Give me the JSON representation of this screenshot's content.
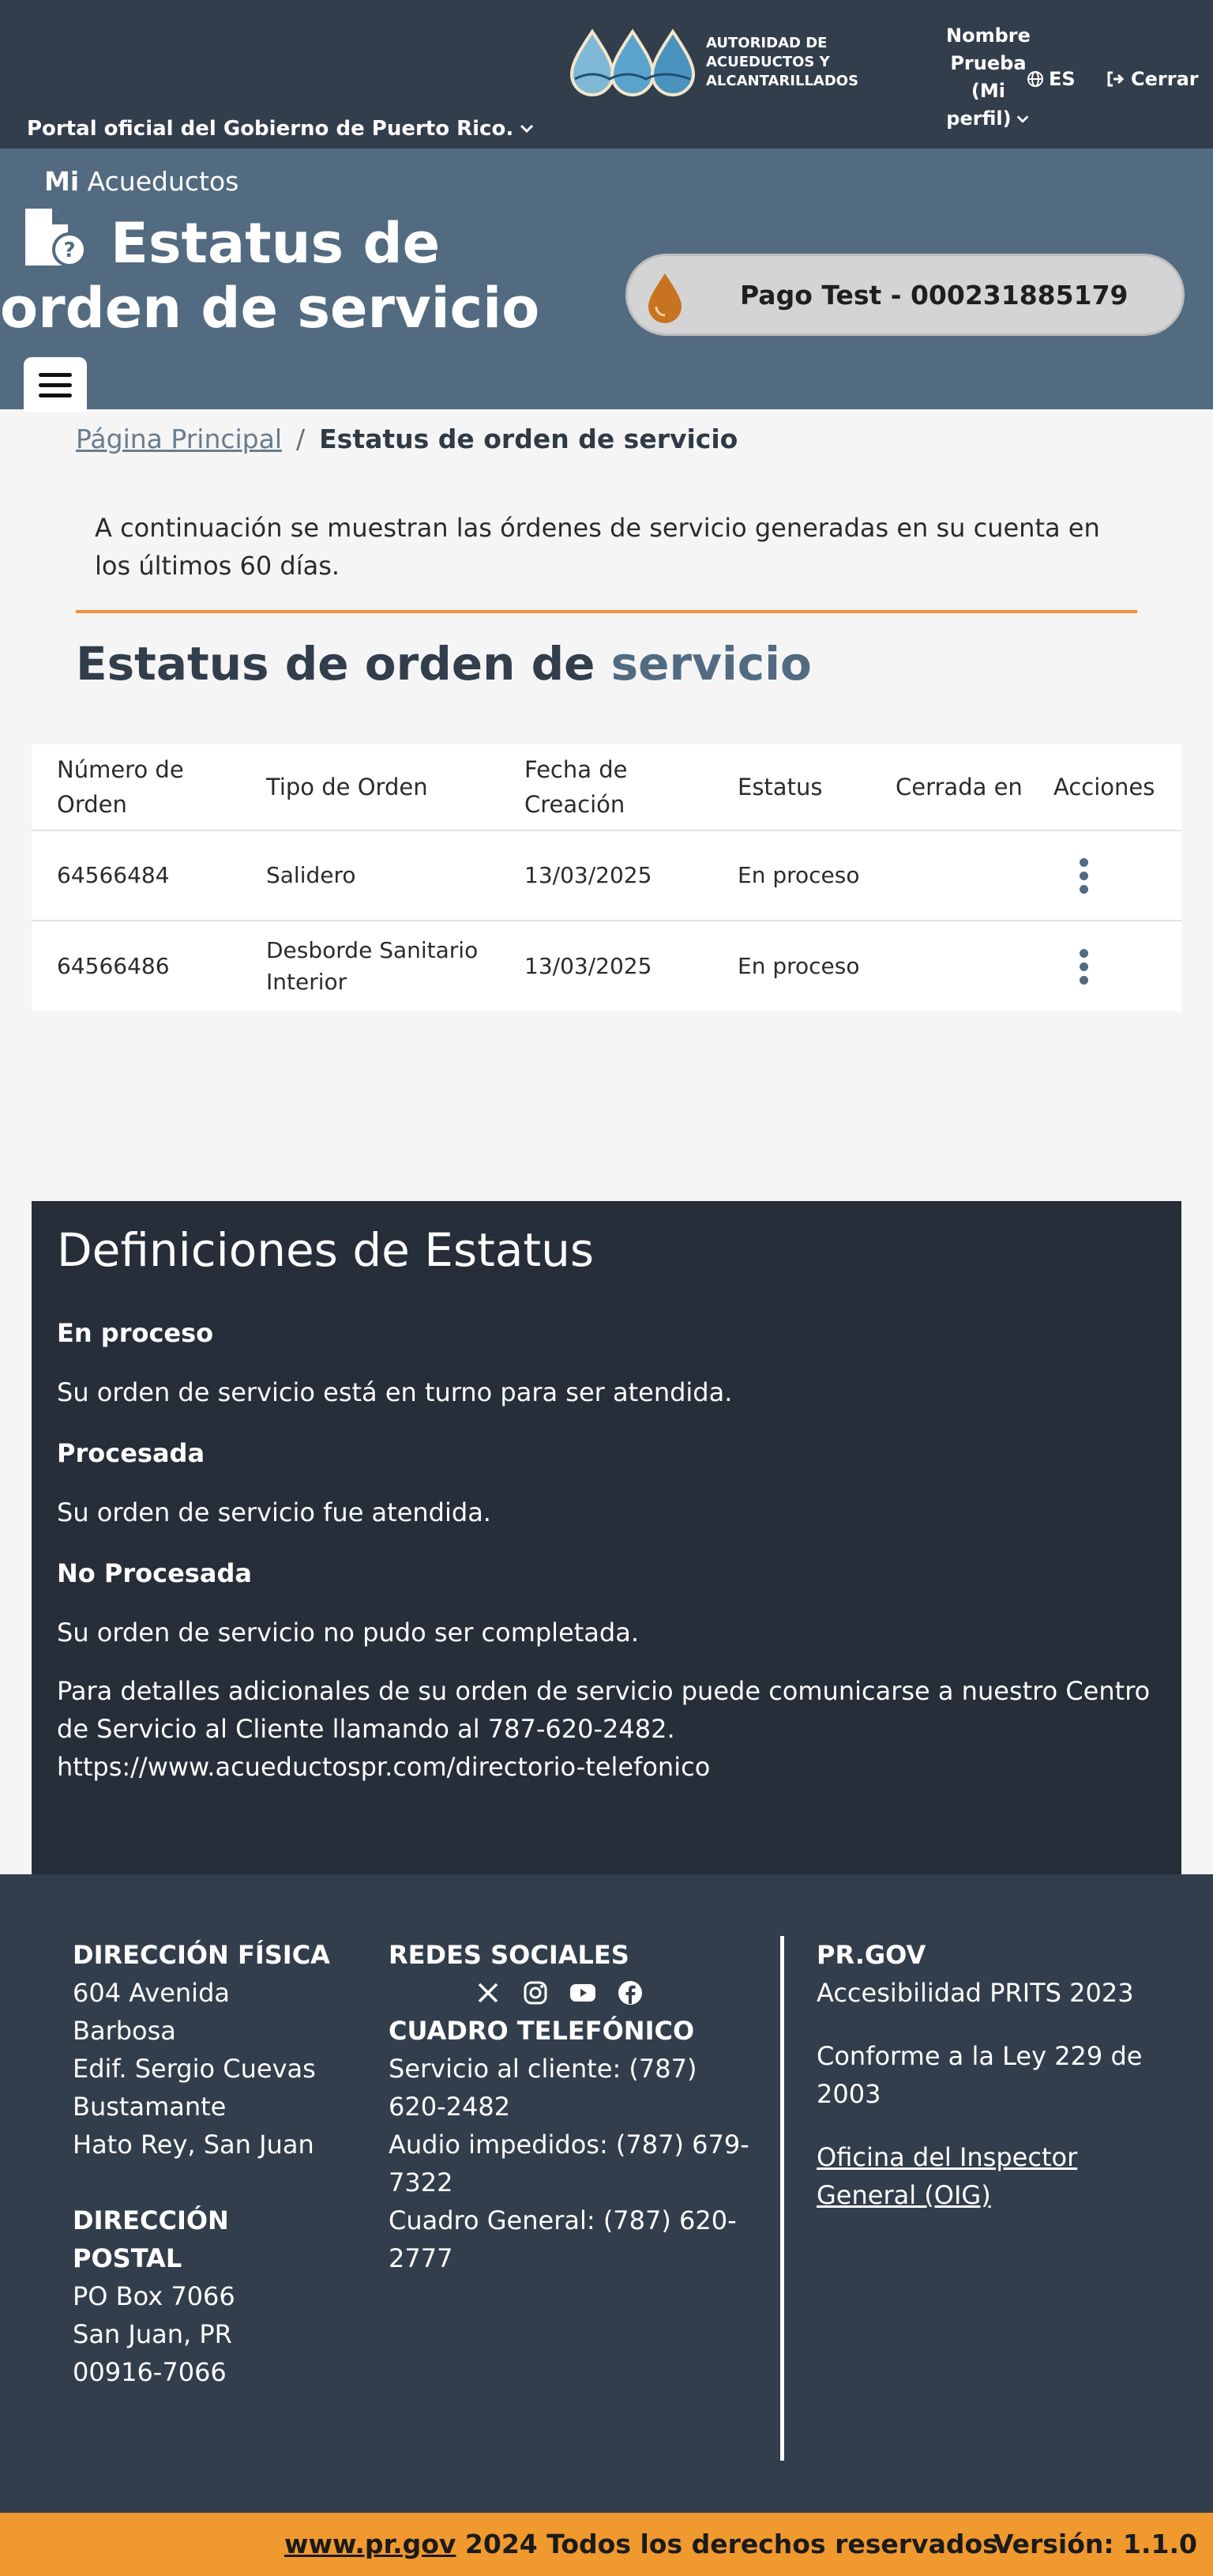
{
  "topbar": {
    "gov_link": "Portal oficial del Gobierno de Puerto Rico.",
    "logo_text": "AUTORIDAD DE ACUEDUCTOS Y ALCANTARILLADOS",
    "user_lines": [
      "Nombre",
      "Prueba",
      "(Mi",
      "perfil)"
    ],
    "lang": "ES",
    "logout": "Cerrar"
  },
  "header": {
    "brand_bold": "Mi",
    "brand_rest": " Acueductos",
    "title": "Estatus de orden de servicio",
    "account": "Pago Test - 000231885179"
  },
  "breadcrumb": {
    "home": "Página Principal",
    "separator": "/",
    "current": "Estatus de orden de servicio"
  },
  "intro": "A continuación se muestran las órdenes de servicio generadas en su cuenta en los últimos 60 días.",
  "section": {
    "title_normal": "Estatus de orden de ",
    "title_bold": "servicio"
  },
  "table": {
    "headers": [
      "Número de Orden",
      "Tipo de Orden",
      "Fecha de Creación",
      "Estatus",
      "Cerrada en",
      "Acciones"
    ],
    "rows": [
      {
        "numero": "64566484",
        "tipo": "Salidero",
        "fecha": "13/03/2025",
        "estatus": "En proceso",
        "cerrada": ""
      },
      {
        "numero": "64566486",
        "tipo": "Desborde Sanitario Interior",
        "fecha": "13/03/2025",
        "estatus": "En proceso",
        "cerrada": ""
      }
    ]
  },
  "definitions": {
    "title": "Definiciones de Estatus",
    "items": [
      {
        "term": "En proceso",
        "desc": "Su orden de servicio está en turno para ser atendida."
      },
      {
        "term": "Procesada",
        "desc": "Su orden de servicio fue atendida."
      },
      {
        "term": "No Procesada",
        "desc": "Su orden de servicio no pudo ser completada."
      }
    ],
    "note": "Para detalles adicionales de su orden de servicio puede comunicarse a nuestro Centro de Servicio al Cliente llamando al 787-620-2482.",
    "note_url": "https://www.acueductospr.com/directorio-telefonico"
  },
  "footer": {
    "fisica_title": "DIRECCIÓN FÍSICA",
    "fisica_lines": [
      "604 Avenida",
      "Barbosa",
      "Edif. Sergio Cuevas",
      "Bustamante",
      "Hato Rey, San Juan"
    ],
    "postal_title": "DIRECCIÓN POSTAL",
    "postal_lines": [
      "PO Box 7066",
      "San Juan, PR",
      "00916-7066"
    ],
    "redes_title": "REDES SOCIALES",
    "social_icons": [
      "x-icon",
      "instagram-icon",
      "youtube-icon",
      "facebook-icon"
    ],
    "cuadro_title": "CUADRO TELEFÓNICO",
    "phones": [
      "Servicio al cliente: (787) 620-2482",
      "Audio impedidos: (787) 679-7322",
      "Cuadro General: (787) 620-2777"
    ],
    "prgov_title": "PR.GOV",
    "prgov_items": [
      "Accesibilidad PRITS 2023",
      "Conforme a la Ley 229 de 2003"
    ],
    "oig_link": "Oficina del Inspector General (OIG)"
  },
  "bottom": {
    "link": "www.pr.gov",
    "rights": " 2024 Todos los derechos reservados",
    "version": "Versión: 1.1.0"
  },
  "colors": {
    "topbar": "#323e4c",
    "header": "#526b80",
    "accent": "#f0923a",
    "definitions_bg": "#262e3a",
    "bottom_bar": "#f0992f"
  }
}
